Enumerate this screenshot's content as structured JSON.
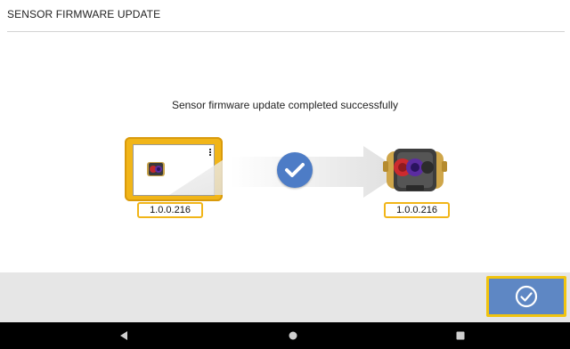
{
  "header": {
    "title": "SENSOR FIRMWARE UPDATE"
  },
  "main": {
    "status_message": "Sensor firmware update completed successfully",
    "source_device": {
      "icon": "tablet-device-icon",
      "version": "1.0.0.216"
    },
    "target_device": {
      "icon": "sensor-device-icon",
      "version": "1.0.0.216"
    },
    "transfer_status_icon": "check-circle-icon"
  },
  "action_bar": {
    "confirm_icon": "check-circle-outline-icon"
  },
  "navigation_bar": {
    "back_icon": "back-triangle-icon",
    "home_icon": "home-circle-icon",
    "recents_icon": "recents-square-icon"
  },
  "colors": {
    "accent_yellow": "#f1b518",
    "accent_blue": "#4d7cc6",
    "button_blue": "#5e87c4",
    "action_bar_bg": "#e6e6e6",
    "nav_bar_bg": "#000000"
  }
}
